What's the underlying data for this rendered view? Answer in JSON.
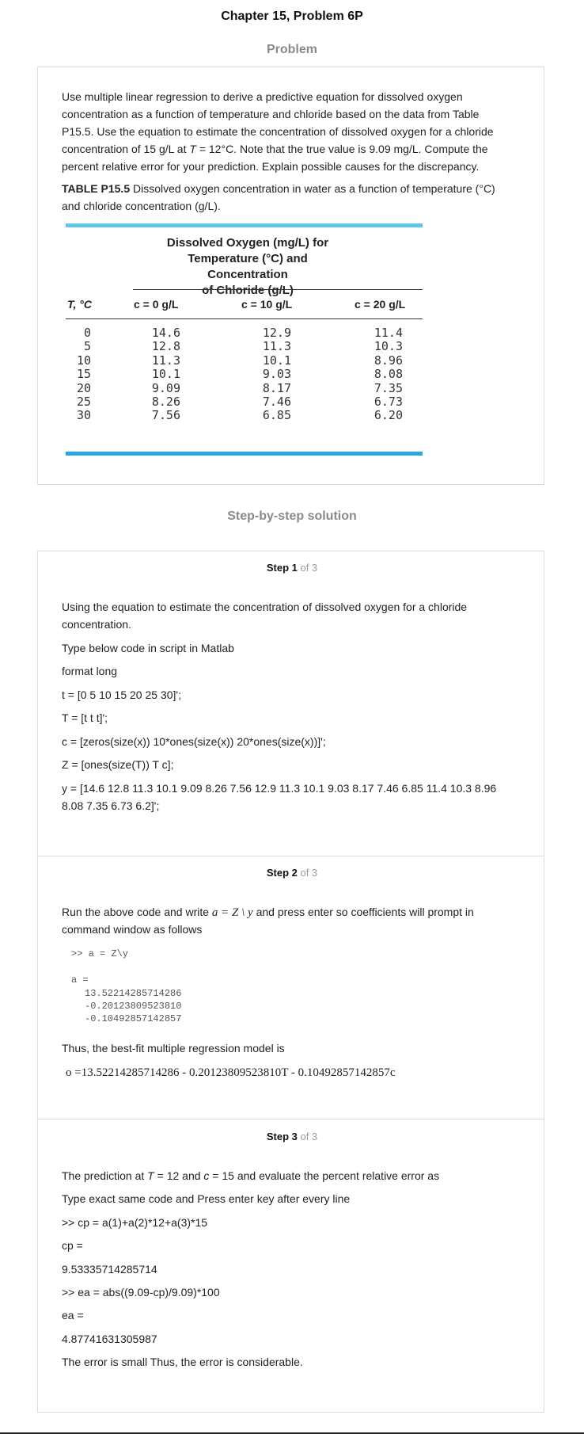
{
  "page_title": "Chapter 15, Problem 6P",
  "problem_heading": "Problem",
  "problem_text": [
    "Use multiple linear regression to derive a predictive equation for dissolved oxygen",
    "concentration as a function of temperature and chloride based on the data from Table",
    "P15.5. Use the equation to estimate the concentration of dissolved oxygen for a chloride",
    "concentration of 15 g/L at ",
    "T",
    " = 12°C. Note that the true value is 9.09 mg/L. Compute the",
    "percent relative error for your prediction. Explain possible causes for the discrepancy."
  ],
  "table_label": "TABLE P15.5",
  "table_caption_line1": " Dissolved oxygen concentration in water as a function of temperature (°C)",
  "table_caption_line2": "and chloride concentration (g/L).",
  "table": {
    "header_caption": [
      "Dissolved Oxygen (mg/L) for",
      "Temperature (°C) and Concentration",
      "of Chloride (g/L)"
    ],
    "col_t": "T, °C",
    "col_c0": "c = 0 g/L",
    "col_c10": "c = 10 g/L",
    "col_c20": "c = 20 g/L",
    "T": [
      "0",
      "5",
      "10",
      "15",
      "20",
      "25",
      "30"
    ],
    "c0": [
      "14.6",
      "12.8",
      "11.3",
      "10.1",
      "9.09",
      "8.26",
      "7.56"
    ],
    "c10": [
      "12.9",
      "11.3",
      "10.1",
      "9.03",
      "8.17",
      "7.46",
      "6.85"
    ],
    "c20": [
      "11.4",
      "10.3",
      "8.96",
      "8.08",
      "7.35",
      "6.73",
      "6.20"
    ]
  },
  "solution_heading": "Step-by-step solution",
  "steps": [
    {
      "label": "Step 1",
      "of": " of 3",
      "lines": [
        "Using the equation to estimate the concentration of dissolved oxygen for a chloride",
        "concentration.",
        "Type below code in script in Matlab",
        "format long",
        "t = [0 5 10 15 20 25 30]';",
        "T = [t t t]';",
        "c = [zeros(size(x)) 10*ones(size(x)) 20*ones(size(x))]';",
        "Z = [ones(size(T)) T c];",
        "y = [14.6 12.8 11.3 10.1 9.09 8.26 7.56 12.9 11.3 10.1 9.03 8.17 7.46 6.85 11.4 10.3 8.96",
        "8.08 7.35 6.73 6.2]';"
      ]
    },
    {
      "label": "Step 2",
      "of": " of 3",
      "intro_a": "Run the above code and write ",
      "intro_math": "a = Z \\ y",
      "intro_b": " and press enter so coefficients will prompt in",
      "intro_line2": "command window as follows",
      "cmd": ">> a = Z\\y",
      "out_label": "a =",
      "out_values": [
        "13.52214285714286",
        "-0.20123809523810",
        "-0.10492857142857"
      ],
      "model_text": "Thus, the best-fit multiple regression model is",
      "model_eq": "o =13.52214285714286 - 0.20123809523810T - 0.10492857142857c"
    },
    {
      "label": "Step 3",
      "of": " of 3",
      "line1_a": "The prediction at ",
      "line1_T": "T",
      "line1_b": " = 12 and ",
      "line1_c": "c",
      "line1_d": " = 15 and evaluate the percent relative error as",
      "lines": [
        "Type exact same code and Press enter key after every line",
        ">> cp = a(1)+a(2)*12+a(3)*15",
        "cp =",
        "9.53335714285714",
        ">> ea = abs((9.09-cp)/9.09)*100",
        "ea =",
        "4.87741631305987",
        "The error is small Thus, the error is considerable."
      ]
    }
  ]
}
